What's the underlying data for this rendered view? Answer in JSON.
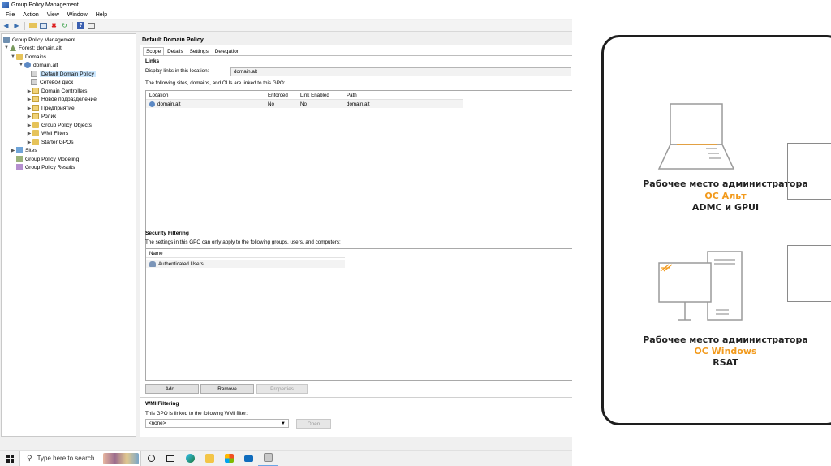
{
  "window": {
    "title": "Group Policy Management"
  },
  "menu": [
    "File",
    "Action",
    "View",
    "Window",
    "Help"
  ],
  "toolbar_icons": [
    "back-icon",
    "forward-icon",
    "up-folder-icon",
    "show-hide-tree-icon",
    "delete-icon",
    "refresh-icon",
    "help-icon",
    "properties-icon"
  ],
  "tree": {
    "root": "Group Policy Management",
    "forest": "Forest: domain.alt",
    "domains": "Domains",
    "domain": "domain.alt",
    "items": [
      "Default Domain Policy",
      "Сетевой диск",
      "Domain Controllers",
      "Новое подразделение",
      "Предприятие",
      "Ролик",
      "Group Policy Objects",
      "WMI Filters",
      "Starter GPOs"
    ],
    "sites": "Sites",
    "modeling": "Group Policy Modeling",
    "results": "Group Policy Results"
  },
  "pane": {
    "title": "Default Domain Policy",
    "tabs": [
      "Scope",
      "Details",
      "Settings",
      "Delegation"
    ],
    "links": {
      "heading": "Links",
      "display_label": "Display links in this location:",
      "display_value": "domain.alt",
      "description": "The following sites, domains, and OUs are linked to this GPO:",
      "columns": [
        "Location",
        "Enforced",
        "Link Enabled",
        "Path"
      ],
      "rows": [
        [
          "domain.alt",
          "No",
          "No",
          "domain.alt"
        ]
      ]
    },
    "security": {
      "heading": "Security Filtering",
      "description": "The settings in this GPO can only apply to the following groups, users, and computers:",
      "column": "Name",
      "rows": [
        "Authenticated Users"
      ],
      "buttons": [
        "Add...",
        "Remove",
        "Properties"
      ]
    },
    "wmi": {
      "heading": "WMI Filtering",
      "description": "This GPO is linked to the following WMI filter:",
      "value": "<none>",
      "button": "Open"
    }
  },
  "taskbar": {
    "search_placeholder": "Type here to search",
    "apps": [
      "task-view-icon",
      "edge-icon",
      "file-explorer-icon",
      "store-icon",
      "mail-icon",
      "gpmc-icon"
    ]
  },
  "diagram": {
    "workstations": [
      {
        "title": "Рабочее место администратора",
        "os": "ОС Альт",
        "tools": "ADMC и GPUI"
      },
      {
        "title": "Рабочее место администратора",
        "os": "ОС Windows",
        "tools": "RSAT"
      }
    ],
    "accent_color": "#f29a1c"
  }
}
